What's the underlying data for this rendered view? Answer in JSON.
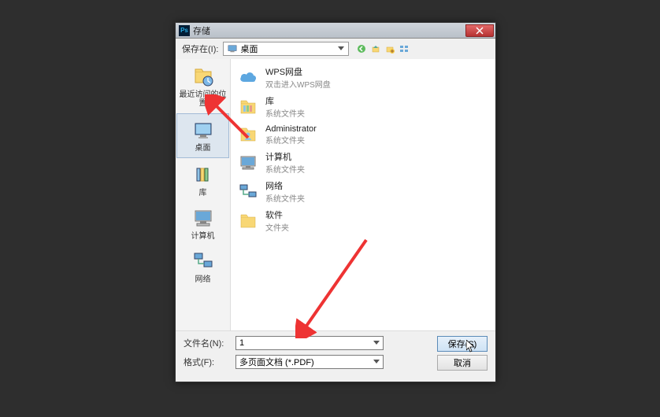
{
  "titlebar": {
    "ps_icon_text": "Ps",
    "title": "存储"
  },
  "toolbar": {
    "save_in_label": "保存在(I):",
    "location_value": "桌面"
  },
  "sidebar": {
    "items": [
      {
        "label": "最近访问的位置",
        "selected": false
      },
      {
        "label": "桌面",
        "selected": true
      },
      {
        "label": "库",
        "selected": false
      },
      {
        "label": "计算机",
        "selected": false
      },
      {
        "label": "网络",
        "selected": false
      }
    ]
  },
  "files": [
    {
      "name": "WPS网盘",
      "sub": "双击进入WPS网盘",
      "icon": "cloud"
    },
    {
      "name": "库",
      "sub": "系统文件夹",
      "icon": "library"
    },
    {
      "name": "Administrator",
      "sub": "系统文件夹",
      "icon": "user"
    },
    {
      "name": "计算机",
      "sub": "系统文件夹",
      "icon": "computer"
    },
    {
      "name": "网络",
      "sub": "系统文件夹",
      "icon": "network"
    },
    {
      "name": "软件",
      "sub": "文件夹",
      "icon": "folder"
    }
  ],
  "form": {
    "filename_label": "文件名(N):",
    "filename_value": "1",
    "format_label": "格式(F):",
    "format_value": "多页面文档 (*.PDF)",
    "save_btn": "保存(S)",
    "cancel_btn": "取消"
  }
}
